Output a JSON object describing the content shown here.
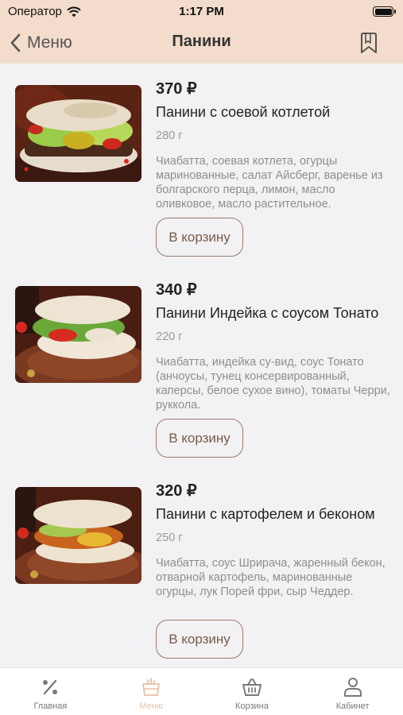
{
  "status_bar": {
    "carrier": "Оператор",
    "time": "1:17 PM"
  },
  "nav": {
    "back_label": "Меню",
    "title": "Панини",
    "bookmark_icon": "bookmark-icon"
  },
  "items": [
    {
      "price": "370 ₽",
      "name": "Панини с соевой котлетой",
      "weight": "280 г",
      "description": "Чиабатта, соевая котлета, огурцы маринованные, салат Айсберг, варенье из болгарского перца, лимон, масло оливковое, масло растительное.",
      "button": "В корзину"
    },
    {
      "price": "340 ₽",
      "name": "Панини Индейка с соусом Тонато",
      "weight": "220 г",
      "description": "Чиабатта, индейка су-вид, соус Тонато (анчоусы, тунец консервированный, каперсы, белое сухое вино), томаты Черри, руккола.",
      "button": "В корзину"
    },
    {
      "price": "320 ₽",
      "name": "Панини с картофелем и беконом",
      "weight": "250 г",
      "description": "Чиабатта, соус Шрирача, жаренный бекон, отварной картофель, маринованные огурцы, лук Порей фри, сыр Чеддер.",
      "button": "В корзину"
    }
  ],
  "tabbar": {
    "active": "Меню",
    "accent": "#e9bfa5",
    "tabs": [
      {
        "label": "Главная",
        "icon": "percent-icon"
      },
      {
        "label": "Меню",
        "icon": "menu-icon"
      },
      {
        "label": "Корзина",
        "icon": "basket-icon"
      },
      {
        "label": "Кабинет",
        "icon": "user-icon"
      }
    ]
  },
  "colors": {
    "header_bg": "#f3dccb",
    "button_border": "#9b7a68",
    "page_bg": "#f2f2f4"
  }
}
